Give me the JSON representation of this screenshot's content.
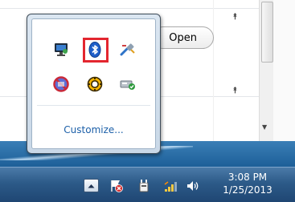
{
  "background_window": {
    "open_button_label": "Open"
  },
  "overflow_popup": {
    "customize_link": "Customize...",
    "icons": [
      "network-monitor-icon",
      "bluetooth-icon",
      "usb-plug-icon",
      "block-shield-icon",
      "gear-app-icon",
      "safely-remove-hardware-icon"
    ],
    "highlight_color": "#e3262f"
  },
  "taskbar": {
    "time": "3:08 PM",
    "date": "1/25/2013",
    "tray_icons": [
      "action-center-flag-icon",
      "power-plug-icon",
      "signal-bars-icon",
      "volume-icon"
    ]
  }
}
